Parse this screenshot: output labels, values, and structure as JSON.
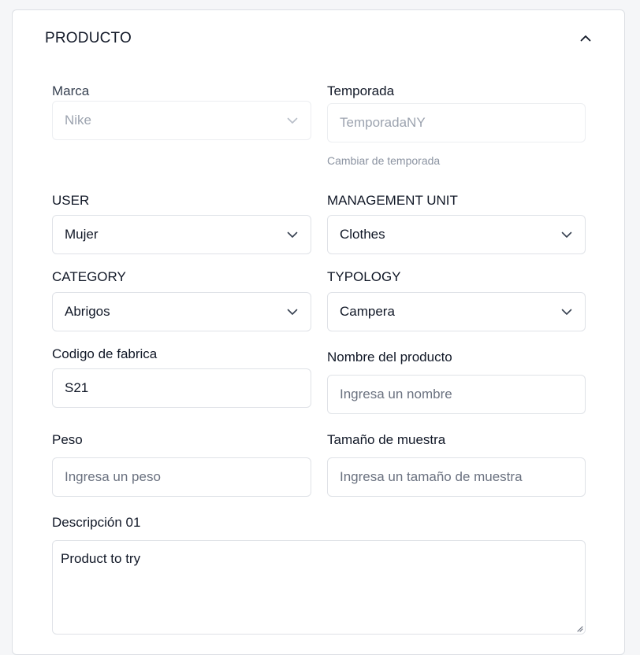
{
  "section": {
    "title": "PRODUCTO",
    "collapse_icon": "chevron-up-icon"
  },
  "fields": {
    "marca": {
      "label": "Marca",
      "value": "Nike",
      "disabled": true
    },
    "temporada": {
      "label": "Temporada",
      "value": "TemporadaNY",
      "hint": "Cambiar de temporada",
      "disabled": true
    },
    "user": {
      "label": "USER",
      "value": "Mujer"
    },
    "management_unit": {
      "label": "MANAGEMENT UNIT",
      "value": "Clothes"
    },
    "category": {
      "label": "CATEGORY",
      "value": "Abrigos"
    },
    "typology": {
      "label": "TYPOLOGY",
      "value": "Campera"
    },
    "codigo_fabrica": {
      "label": "Codigo de fabrica",
      "value": "S21"
    },
    "nombre_producto": {
      "label": "Nombre del producto",
      "placeholder": "Ingresa un nombre"
    },
    "peso": {
      "label": "Peso",
      "placeholder": "Ingresa un peso"
    },
    "tamano_muestra": {
      "label": "Tamaño de muestra",
      "placeholder": "Ingresa un tamaño de muestra"
    },
    "descripcion_01": {
      "label": "Descripción 01",
      "value": "Product to try"
    }
  },
  "colors": {
    "border": "#dfe2e7",
    "text": "#111827",
    "muted": "#9ca3af",
    "placeholder": "#6b7280"
  }
}
